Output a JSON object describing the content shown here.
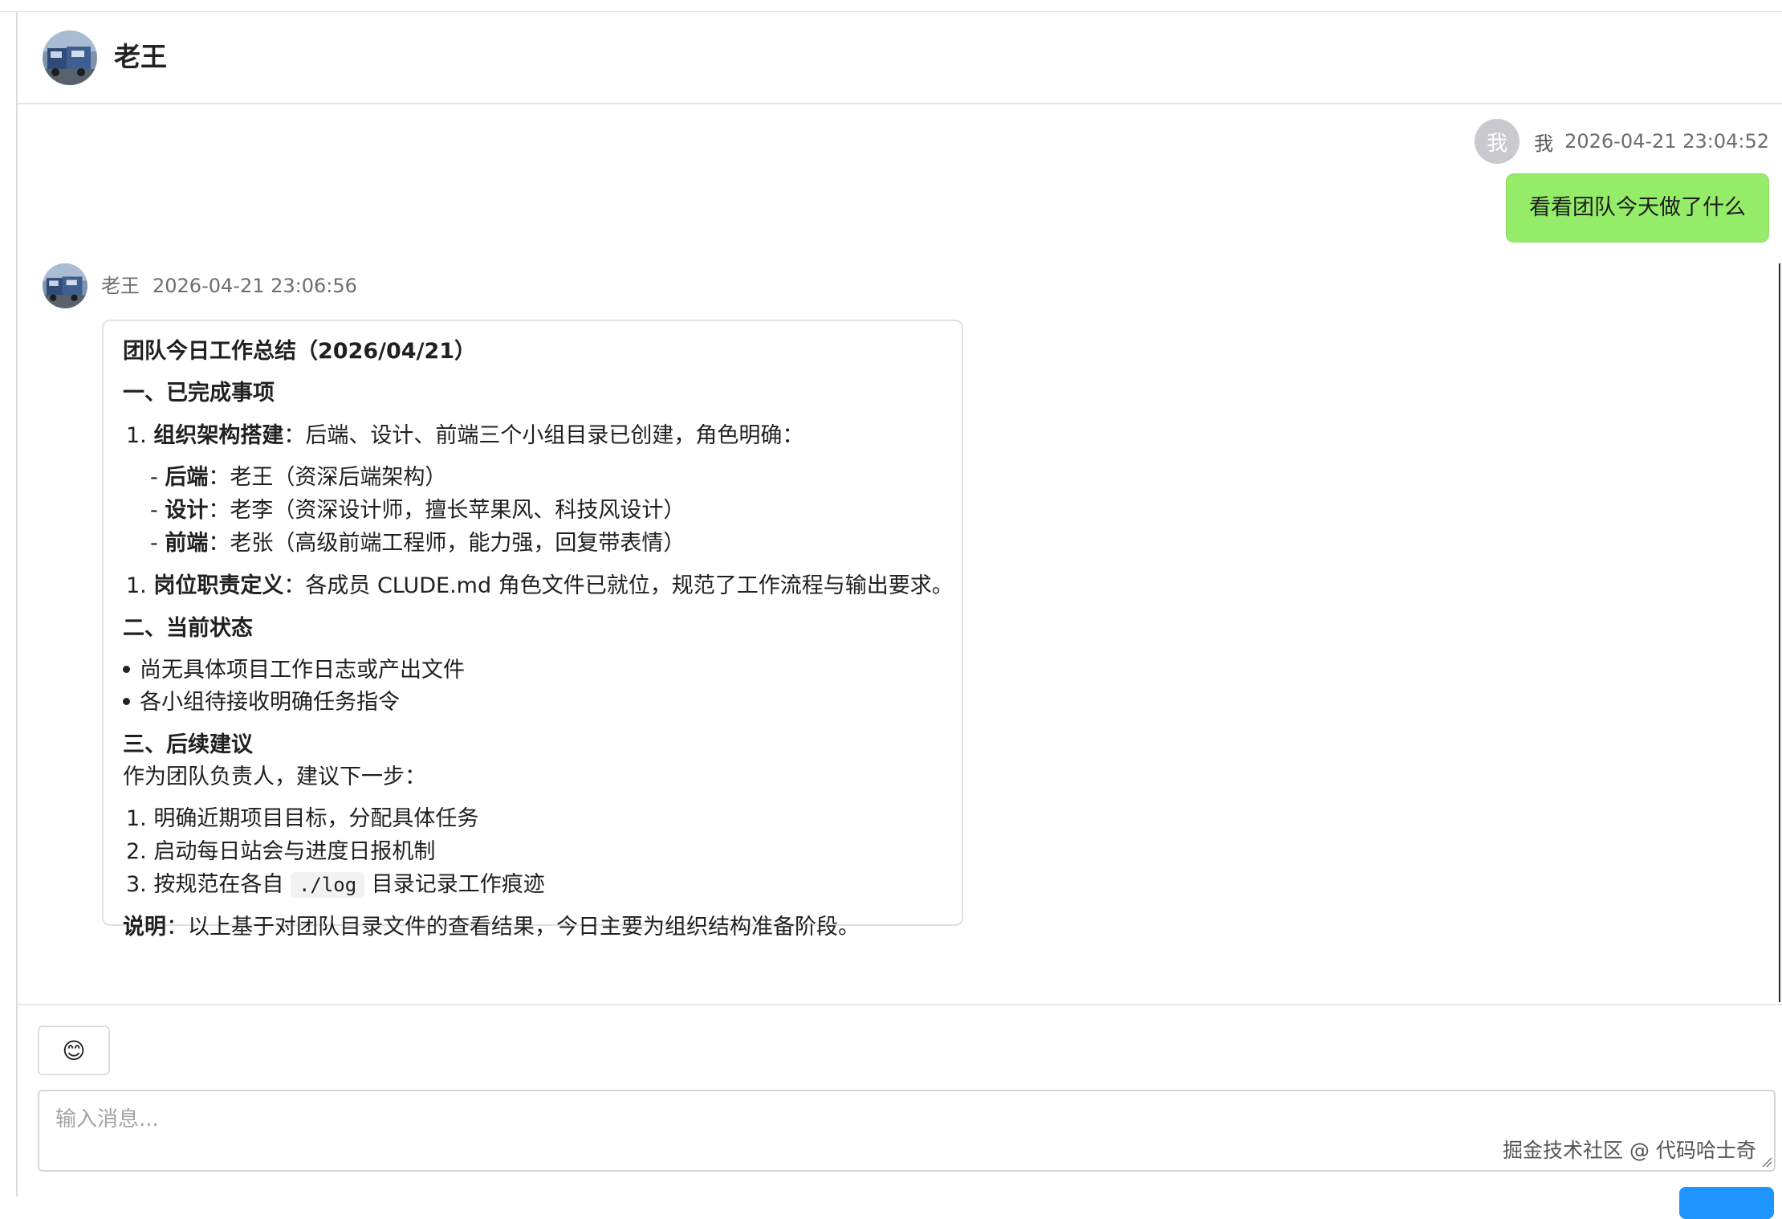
{
  "header": {
    "title": "老王",
    "avatar_icon": "truck-photo-avatar"
  },
  "messages": {
    "me": {
      "avatar_text": "我",
      "name": "我",
      "time": "2026-04-21 23:04:52",
      "text": "看看团队今天做了什么",
      "bubble_color": "#95ec69"
    },
    "bot": {
      "name": "老王",
      "time": "2026-04-21 23:06:56",
      "title": "团队今日工作总结（2026/04/21）",
      "sec1_heading": "一、已完成事项",
      "item1_num": "1.",
      "item1_label": "组织架构搭建",
      "item1_text": "：后端、设计、前端三个小组目录已创建，角色明确：",
      "sub1_label": "后端",
      "sub1_text": "：老王（资深后端架构）",
      "sub2_label": "设计",
      "sub2_text": "：老李（资深设计师，擅长苹果风、科技风设计）",
      "sub3_label": "前端",
      "sub3_text": "：老张（高级前端工程师，能力强，回复带表情）",
      "item2_num": "1.",
      "item2_label": "岗位职责定义",
      "item2_text": "：各成员 CLUDE.md 角色文件已就位，规范了工作流程与输出要求。",
      "sec2_heading": "二、当前状态",
      "bullets": [
        "尚无具体项目工作日志或产出文件",
        "各小组待接收明确任务指令"
      ],
      "sec3_heading": "三、后续建议",
      "intro": "作为团队负责人，建议下一步：",
      "step1": "1. 明确近期项目目标，分配具体任务",
      "step2": "2. 启动每日站会与进度日报机制",
      "step3_prefix": "3. 按规范在各自 ",
      "step3_code": "./log",
      "step3_suffix": " 目录记录工作痕迹",
      "note_label": "说明",
      "note_text": "：以上基于对团队目录文件的查看结果，今日主要为组织结构准备阶段。"
    }
  },
  "composer": {
    "emoji": "😊",
    "placeholder": "输入消息...",
    "watermark": "掘金技术社区 @ 代码哈士奇"
  }
}
